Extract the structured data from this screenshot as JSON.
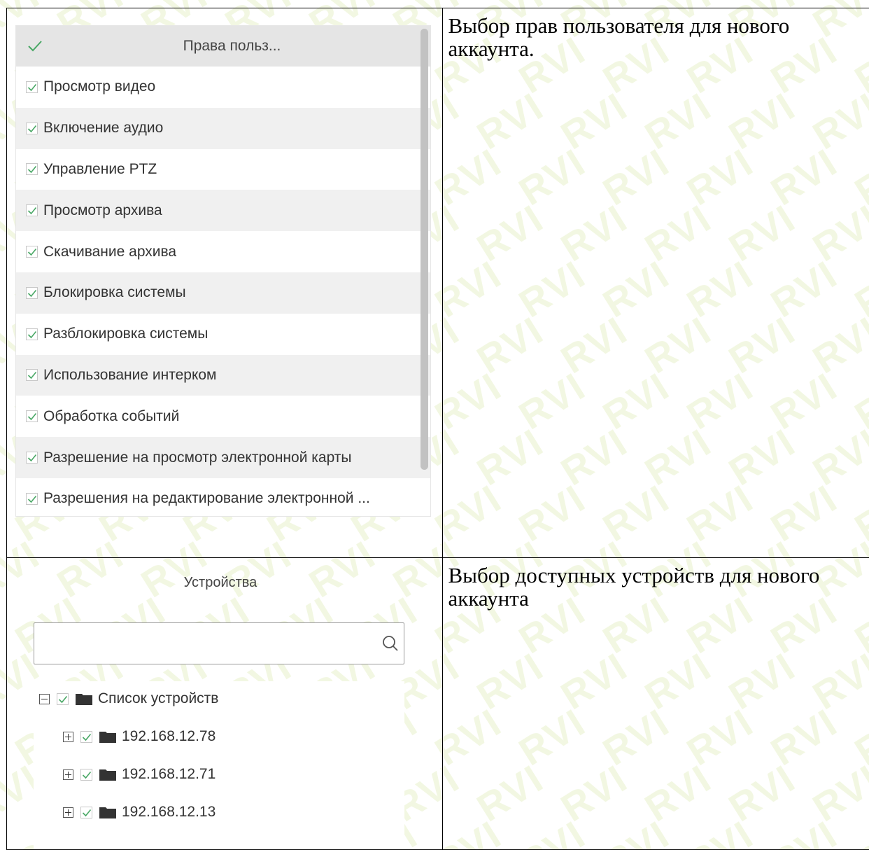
{
  "rights_panel": {
    "header_title": "Права польз...",
    "items": [
      {
        "label": "Просмотр видео",
        "checked": true
      },
      {
        "label": "Включение аудио",
        "checked": true
      },
      {
        "label": "Управление PTZ",
        "checked": true
      },
      {
        "label": "Просмотр архива",
        "checked": true
      },
      {
        "label": "Скачивание архива",
        "checked": true
      },
      {
        "label": "Блокировка системы",
        "checked": true
      },
      {
        "label": "Разблокировка системы",
        "checked": true
      },
      {
        "label": "Использование интерком",
        "checked": true
      },
      {
        "label": "Обработка событий",
        "checked": true
      },
      {
        "label": "Разрешение на просмотр электронной карты",
        "checked": true
      },
      {
        "label": "Разрешения на редактирование электронной ...",
        "checked": true
      }
    ]
  },
  "descriptions": {
    "rights": "Выбор прав пользователя для нового аккаунта.",
    "devices": "Выбор доступных устройств для нового аккаунта"
  },
  "devices_panel": {
    "title": "Устройства",
    "search_placeholder": "",
    "tree": {
      "root_label": "Список устройств",
      "children": [
        "192.168.12.78",
        "192.168.12.71",
        "192.168.12.13"
      ]
    }
  },
  "colors": {
    "check": "#4aa866",
    "header_bg": "#e5e5e5",
    "row_alt_bg": "#f0f0f0",
    "watermark": "#d2e196"
  },
  "watermark_text": "RVI"
}
